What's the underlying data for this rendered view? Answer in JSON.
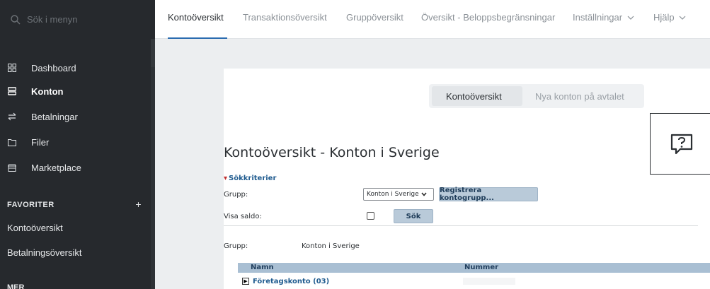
{
  "sidebar": {
    "search_placeholder": "Sök i menyn",
    "items": [
      {
        "label": "Dashboard",
        "icon": "dashboard-icon"
      },
      {
        "label": "Konton",
        "icon": "accounts-icon"
      },
      {
        "label": "Betalningar",
        "icon": "transfer-icon"
      },
      {
        "label": "Filer",
        "icon": "folder-icon"
      },
      {
        "label": "Marketplace",
        "icon": "store-icon"
      }
    ],
    "favorites_title": "FAVORITER",
    "favorites_add": "+",
    "favorites": [
      "Kontoöversikt",
      "Betalningsöversikt"
    ],
    "more_title": "MER"
  },
  "topbar": {
    "tabs": [
      "Kontoöversikt",
      "Transaktionsöversikt",
      "Gruppöversikt",
      "Översikt - Beloppsbegränsningar",
      "Inställningar",
      "Hjälp"
    ]
  },
  "main": {
    "segment": [
      "Kontoöversikt",
      "Nya konton på avtalet"
    ],
    "title": "Kontoöversikt - Konton i Sverige",
    "criteria_label": "Sökkriterier",
    "group_label": "Grupp:",
    "group_value": "Konton i Sverige",
    "register_button": "Registrera kontogrupp...",
    "show_balance_label": "Visa saldo:",
    "search_button": "Sök",
    "summary_group_label": "Grupp:",
    "summary_group_value": "Konton i Sverige",
    "columns": [
      "Namn",
      "Nummer"
    ],
    "rows": [
      {
        "name": "Företagskonto (03)"
      }
    ]
  },
  "colors": {
    "sidebar_bg": "#26292d",
    "accent": "#2b6cb0",
    "link": "#1f5b8f"
  }
}
